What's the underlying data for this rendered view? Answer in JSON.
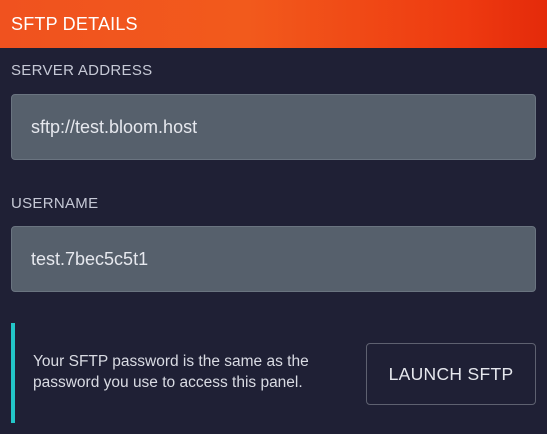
{
  "header": {
    "title": "SFTP DETAILS"
  },
  "server_address": {
    "label": "SERVER ADDRESS",
    "value": "sftp://test.bloom.host"
  },
  "username": {
    "label": "USERNAME",
    "value": "test.7bec5c5t1"
  },
  "notice": {
    "text": "Your SFTP password is the same as the password you use to access this panel."
  },
  "launch_button": {
    "label": "LAUNCH SFTP"
  },
  "colors": {
    "background": "#1f2035",
    "header_gradient_start": "#f0521f",
    "header_gradient_end": "#e42a0a",
    "field_background": "#56606c",
    "notice_accent": "#23c6c8"
  }
}
